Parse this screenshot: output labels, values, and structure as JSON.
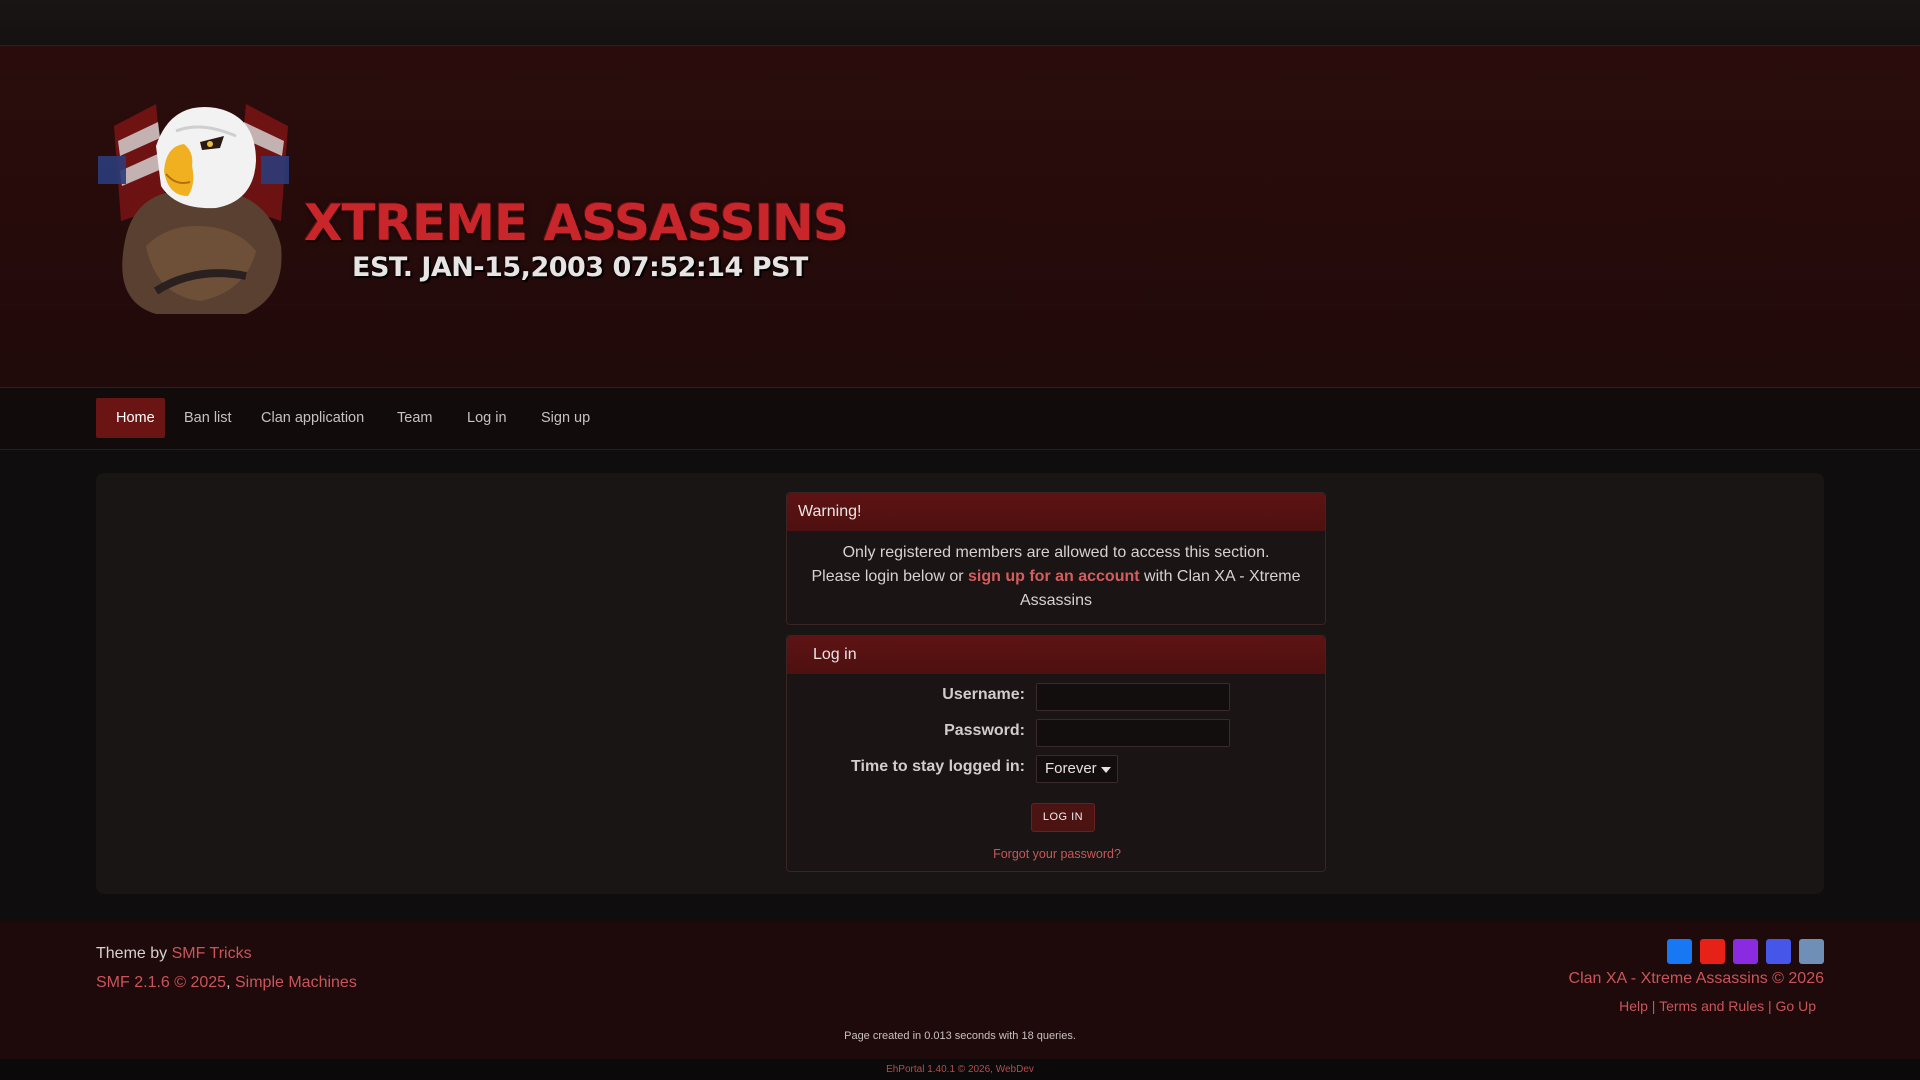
{
  "header": {
    "logo_title": "XTREME ASSASSINS",
    "logo_subtitle": "EST. JAN-15,2003 07:52:14 PST"
  },
  "nav": {
    "items": [
      {
        "label": "Home",
        "active": true
      },
      {
        "label": "Ban list"
      },
      {
        "label": "Clan application"
      },
      {
        "label": "Team"
      },
      {
        "label": "Log in"
      },
      {
        "label": "Sign up"
      }
    ]
  },
  "warning": {
    "title": "Warning!",
    "line1": "Only registered members are allowed to access this section.",
    "line2_pre": "Please login below or",
    "line2_link": "sign up for an account",
    "line2_post": "with Clan XA - Xtreme Assassins"
  },
  "login": {
    "title": "Log in",
    "username_label": "Username:",
    "username_value": "",
    "password_label": "Password:",
    "password_value": "",
    "stay_label": "Time to stay logged in:",
    "stay_value": "Forever",
    "button": "LOG IN",
    "forgot": "Forgot your password?"
  },
  "footer": {
    "theme_by": "Theme by",
    "theme_link": "SMF Tricks",
    "smf_version": "SMF 2.1.6 © 2025",
    "smf_sep": ",",
    "smf_link": "Simple Machines",
    "copyright": "Clan XA - Xtreme Assassins © 2026",
    "links": [
      "Help",
      "Terms and Rules",
      "Go Up"
    ],
    "stats": "Page created in 0.013 seconds with 18 queries.",
    "portal": "EhPortal 1.40.1 © 2026, WebDev"
  },
  "social": [
    {
      "name": "facebook-icon",
      "color": "#1877f2"
    },
    {
      "name": "youtube-icon",
      "color": "#e62117"
    },
    {
      "name": "twitch-icon",
      "color": "#8a2be2"
    },
    {
      "name": "discord-icon",
      "color": "#4556e8"
    },
    {
      "name": "steam-icon",
      "color": "#6f8fb6"
    }
  ],
  "colors": {
    "accent": "#6b1414",
    "link": "#d35d5d",
    "header_bg": "#2a0c0c"
  }
}
